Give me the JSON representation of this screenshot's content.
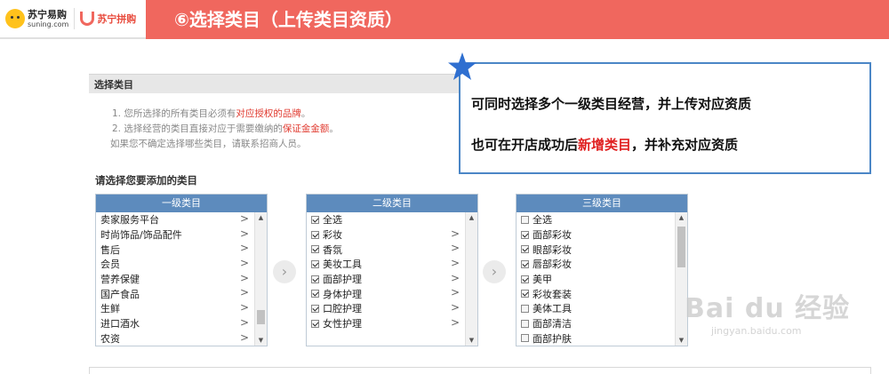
{
  "banner": {
    "title": "⑥选择类目（上传类目资质）",
    "logo1_cn": "苏宁易购",
    "logo1_en": "suning.com",
    "logo2_cn": "苏宁拼购",
    "accent": "#f0675e"
  },
  "section": {
    "title": "选择类目",
    "note1_pre": "1. 您所选择的所有类目必须有",
    "note1_red": "对应授权的品牌",
    "note1_post": "。",
    "note2_pre": "2. 选择经营的类目直接对应于需要缴纳的",
    "note2_red": "保证金金额",
    "note2_post": "。",
    "note3": "如果您不确定选择哪些类目，请联系招商人员。",
    "choose_title": "请选择您要添加的类目"
  },
  "level1": {
    "header": "一级类目",
    "items": [
      "卖家服务平台",
      "时尚饰品/饰品配件",
      "售后",
      "会员",
      "营养保健",
      "国产食品",
      "生鲜",
      "进口酒水",
      "农资"
    ],
    "scroll_up": "▲",
    "scroll_down": "▼",
    "chevron": ">"
  },
  "level2": {
    "header": "二级类目",
    "items": [
      "全选",
      "彩妆",
      "香氛",
      "美妆工具",
      "面部护理",
      "身体护理",
      "口腔护理",
      "女性护理"
    ],
    "checked": [
      true,
      true,
      true,
      true,
      true,
      true,
      true,
      true
    ],
    "scroll_up": "▲",
    "scroll_down": "▼",
    "chevron": ">"
  },
  "level3": {
    "header": "三级类目",
    "items": [
      "全选",
      "面部彩妆",
      "眼部彩妆",
      "唇部彩妆",
      "美甲",
      "彩妆套装",
      "美体工具",
      "面部清洁",
      "面部护肤"
    ],
    "checked": [
      false,
      true,
      true,
      true,
      true,
      true,
      false,
      false,
      false
    ],
    "scroll_up": "▲",
    "scroll_down": "▼"
  },
  "nav": {
    "next1": "›",
    "next2": "›"
  },
  "callout": {
    "line1": "可同时选择多个一级类目经营，并上传对应资质",
    "line2_pre": "也可在开店成功后",
    "line2_red": "新增类目",
    "line2_post": "，并补充对应资质",
    "border_color": "#4b86c6",
    "star_color": "#2f6fd0"
  },
  "watermark": {
    "main": "Bai du 经验",
    "sub": "jingyan.baidu.com"
  }
}
